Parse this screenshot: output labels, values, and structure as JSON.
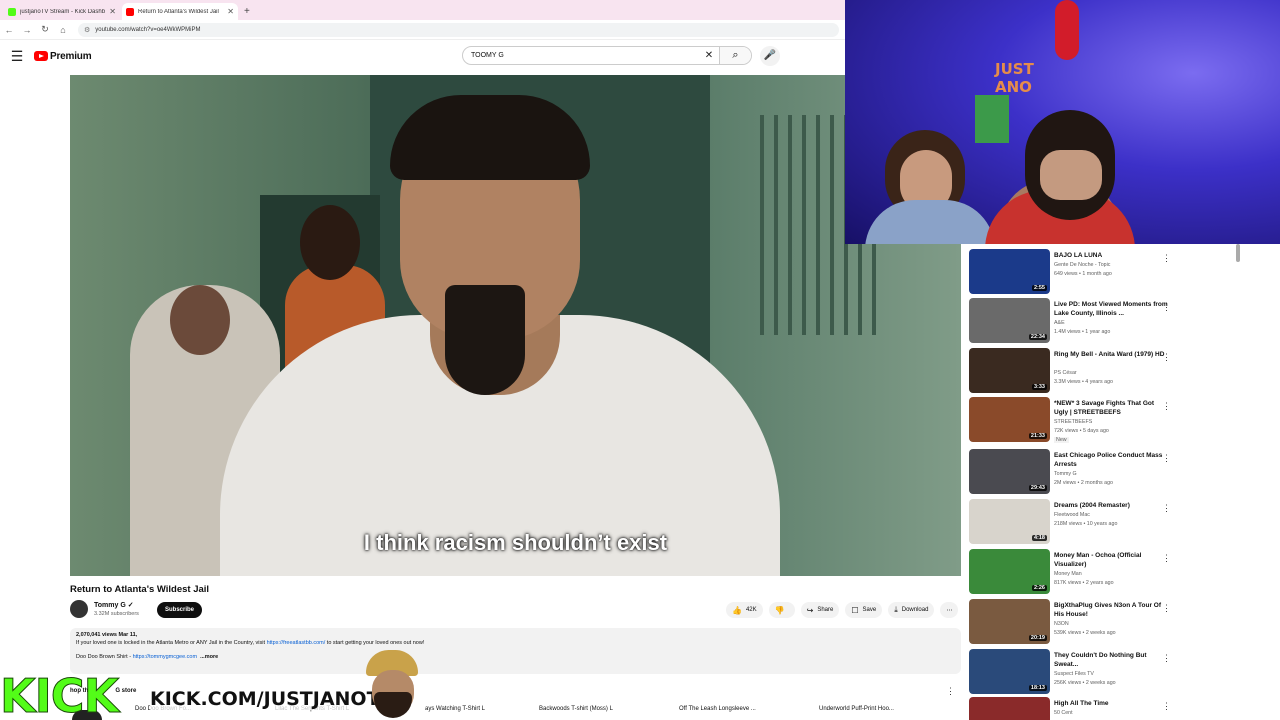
{
  "browser": {
    "tabs": [
      {
        "title": "justjanoTV Stream - Kick Dashb",
        "favicon_color": "#53fc18"
      },
      {
        "title": "Return to Atlanta's Wildest Jail",
        "favicon_color": "#ff0000"
      }
    ],
    "url": "youtube.com/watch?v=oe4WkWPMiPM"
  },
  "youtube": {
    "logo_text": "Premium",
    "search": {
      "query": "TOOMY G"
    }
  },
  "player": {
    "subtitle": "I think racism shouldn’t exist"
  },
  "video": {
    "title": "Return to Atlanta's Wildest Jail",
    "channel": "Tommy G",
    "subscribers": "3.32M subscribers",
    "subscribe_label": "Subscribe",
    "likes": "42K",
    "share_label": "Share",
    "save_label": "Save",
    "download_label": "Download"
  },
  "description": {
    "meta": "2,070,041 views  Mar 11,",
    "line1_a": "If your loved one is locked in the Atlanta Metro or ANY Jail in the Country, visit ",
    "line1_link": "https://freeatlastbb.com/",
    "line1_b": " to start getting your loved ones out now!",
    "line2_a": "Doo Doo Brown Shirt - ",
    "line2_link": "https://tommygmcgee.com",
    "more": "...more"
  },
  "shop": {
    "header": "hop the",
    "header2": "G store",
    "items": [
      "Doo Doo Brown Fo...",
      "Lilac The Serpents T-Shirt L",
      "ays Watching T-Shirt L",
      "Backwoods T-shirt (Moss) L",
      "Off The Leash Longsleeve ...",
      "Underworld Puff-Print Hoo..."
    ]
  },
  "kick": {
    "logo": "KICK",
    "url": "KICK.COM/JUSTJANOTV"
  },
  "webcam": {
    "sign_line1": "JUST",
    "sign_line2": "ANO"
  },
  "recommendations": [
    {
      "title": "BAJO LA LUNA",
      "channel": "Gente De Noche - Topic",
      "stats": "649 views • 1 month ago",
      "duration": "2:55",
      "thumb": "#1b3a8a",
      "badge": ""
    },
    {
      "title": "Live PD: Most Viewed Moments from Lake County, Illinois ...",
      "channel": "A&E",
      "stats": "1.4M views • 1 year ago",
      "duration": "22:34",
      "thumb": "#6a6a6a",
      "badge": ""
    },
    {
      "title": "Ring My Bell - Anita Ward (1979) HD",
      "channel": "PS César",
      "stats": "3.3M views • 4 years ago",
      "duration": "3:33",
      "thumb": "#3a2a20",
      "badge": ""
    },
    {
      "title": "*NEW* 3 Savage Fights That Got Ugly | STREETBEEFS",
      "channel": "STREETBEEFS",
      "stats": "72K views • 5 days ago",
      "duration": "21:33",
      "thumb": "#8a4a2a",
      "badge": "New"
    },
    {
      "title": "East Chicago Police Conduct Mass Arrests",
      "channel": "Tommy G",
      "stats": "2M views • 2 months ago",
      "duration": "29:43",
      "thumb": "#4a4a50",
      "badge": ""
    },
    {
      "title": "Dreams (2004 Remaster)",
      "channel": "Fleetwood Mac",
      "stats": "218M views • 10 years ago",
      "duration": "4:18",
      "thumb": "#d8d4cc",
      "badge": ""
    },
    {
      "title": "Money Man - Ochoa (Official Visualizer)",
      "channel": "Money Man",
      "stats": "817K views • 2 years ago",
      "duration": "2:26",
      "thumb": "#3a8a3a",
      "badge": ""
    },
    {
      "title": "BigXthaPlug Gives N3on A Tour Of His House!",
      "channel": "N3ON",
      "stats": "539K views • 2 weeks ago",
      "duration": "20:19",
      "thumb": "#7a5a40",
      "badge": ""
    },
    {
      "title": "They Couldn't Do Nothing But Sweat...",
      "channel": "Suspect Files TV",
      "stats": "256K views • 2 weeks ago",
      "duration": "18:13",
      "thumb": "#2a4a7a",
      "badge": ""
    },
    {
      "title": "High All The Time",
      "channel": "50 Cent",
      "stats": "",
      "duration": "",
      "thumb": "#8a2a2a",
      "badge": ""
    }
  ]
}
